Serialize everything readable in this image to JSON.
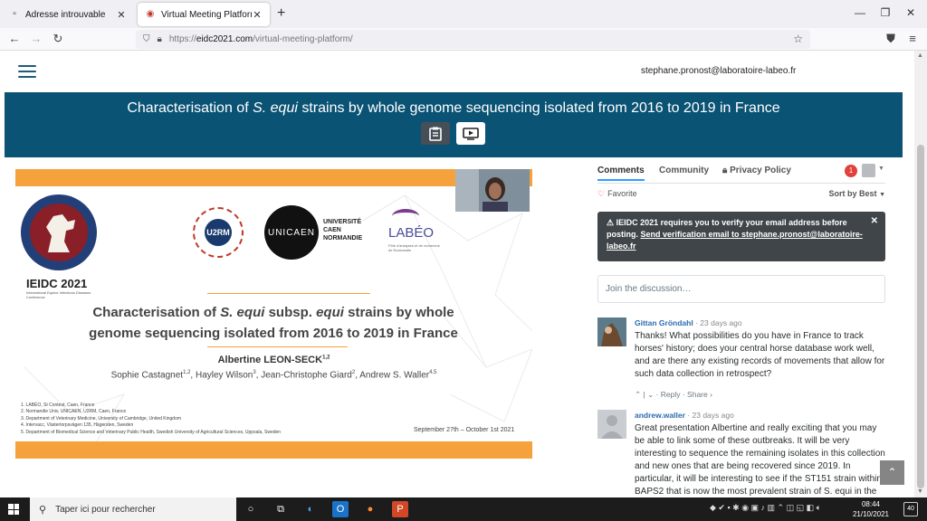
{
  "browser": {
    "tabs": [
      {
        "title": "Adresse introuvable",
        "icon": "page-icon",
        "active": false
      },
      {
        "title": "Virtual Meeting Platform -",
        "icon": "site-favicon",
        "active": true
      }
    ],
    "url_protocol": "https://",
    "url_host": "eidc2021.com",
    "url_path": "/virtual-meeting-platform/"
  },
  "header": {
    "user_email": "stephane.pronost@laboratoire-labeo.fr"
  },
  "banner": {
    "title_pre": "Characterisation of ",
    "title_italic": "S. equi",
    "title_post": " strains by whole genome sequencing isolated from 2016 to 2019 in France",
    "buttons": [
      "clipboard-icon",
      "video-play-icon"
    ],
    "color": "#0a5374"
  },
  "slide": {
    "logo_text": "IEIDC 2021",
    "logo_sub": "International Equine Infectious Diseases Conference",
    "u2rm_text": "U2RM",
    "u2rm_ring": "Unité de Recherche Risques Microbiens",
    "unicaen_logo": "UNICAEN",
    "unicaen_name": "UNIVERSITÉ\nCAEN\nNORMANDIE",
    "labeo_name": "LABÉO",
    "labeo_tag": "Pôle d'analyses et de recherche de Normandie",
    "title_line1_pre": "Characterisation of ",
    "title_line1_italic1": "S. equi",
    "title_line1_mid": " subsp. ",
    "title_line1_italic2": "equi",
    "title_line1_post": " strains by whole",
    "title_line2": "genome sequencing isolated from 2016 to 2019 in France",
    "presenter": "Albertine LEON-SECK",
    "presenter_sup": "1,2",
    "coauthors": [
      {
        "name": "Sophie Castagnet",
        "sup": "1,2"
      },
      {
        "name": "Hayley Wilson",
        "sup": "3"
      },
      {
        "name": "Jean-Christophe Giard",
        "sup": "2"
      },
      {
        "name": "Andrew S. Waller",
        "sup": "4,5"
      }
    ],
    "affiliations": [
      "1. LABÉO, St Contest, Caen, France",
      "2. Normandie Univ, UNICAEN, U2RM, Caen, France",
      "3. Department of Veterinary Medicine, University of Cambridge, United Kingdom",
      "4. Intervacc, Västertorpsvägen 135, Hägersten, Sweden",
      "5. Department of Biomedical Science and Veterinary Public Health, Swedish University of Agricultural Sciences, Uppsala, Sweden"
    ],
    "dates": "September 27th – October 1st 2021",
    "accent": "#f5a23c"
  },
  "comments": {
    "tabs": [
      "Comments",
      "Community",
      "Privacy Policy"
    ],
    "notification_count": "1",
    "favorite": "Favorite",
    "sort": "Sort by Best",
    "alert_text": "IEIDC 2021 requires you to verify your email address before posting.",
    "alert_link": "Send verification email to stephane.pronost@laboratoire-labeo.fr",
    "join_placeholder": "Join the discussion…",
    "posts": [
      {
        "author": "Gittan Gröndahl",
        "time": "23 days ago",
        "text": "Thanks! What possibilities do you have in France to track horses' history; does your central horse database work well, and are there any existing records of movements that allow for such data collection in retrospect?",
        "reply": "Reply",
        "share": "Share ›"
      },
      {
        "author": "andrew.waller",
        "time": "23 days ago",
        "text": "Great presentation Albertine and really exciting that you may be able to link some of these outbreaks. It will be very interesting to sequence the remaining isolates in this collection and new ones that are being recovered since 2019. In particular, it will be interesting to see if the ST151 strain within BAPS2 that is now the most prevalent strain of S. equi in the",
        "reply": "",
        "share": ""
      }
    ]
  },
  "taskbar": {
    "search_placeholder": "Taper ici pour rechercher",
    "time": "08:44",
    "date": "21/10/2021",
    "notifications": "40"
  }
}
